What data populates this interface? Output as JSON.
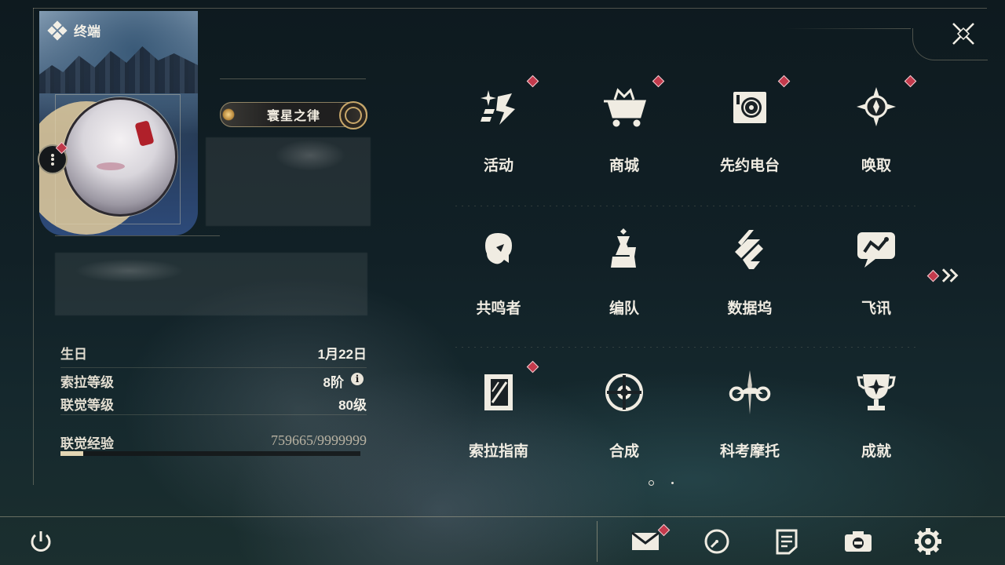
{
  "header": {
    "title": "终端"
  },
  "profile": {
    "title_badge": "寰星之律",
    "info": {
      "birthday_label": "生日",
      "birthday_value": "1月22日",
      "sola_level_label": "索拉等级",
      "sola_level_value": "8阶",
      "sola_info_icon": "i",
      "union_level_label": "联觉等级",
      "union_level_value": "80级",
      "union_exp_label": "联觉经验",
      "union_exp_value": "759665/9999999",
      "union_exp_progress": 0.076
    }
  },
  "menu": {
    "items": [
      {
        "label": "活动",
        "icon": "sparkle-icon",
        "badge": true
      },
      {
        "label": "商城",
        "icon": "shop-cart-icon",
        "badge": true
      },
      {
        "label": "先约电台",
        "icon": "radio-icon",
        "badge": true
      },
      {
        "label": "唤取",
        "icon": "compass-star-icon",
        "badge": true
      },
      {
        "label": "共鸣者",
        "icon": "resonator-portrait-icon",
        "badge": false
      },
      {
        "label": "编队",
        "icon": "chess-team-icon",
        "badge": false
      },
      {
        "label": "数据坞",
        "icon": "data-dock-icon",
        "badge": false
      },
      {
        "label": "飞讯",
        "icon": "chat-bubble-icon",
        "badge": false
      },
      {
        "label": "索拉指南",
        "icon": "guide-book-icon",
        "badge": true
      },
      {
        "label": "合成",
        "icon": "synthesis-icon",
        "badge": false
      },
      {
        "label": "科考摩托",
        "icon": "motorbike-icon",
        "badge": false
      },
      {
        "label": "成就",
        "icon": "trophy-icon",
        "badge": false
      }
    ]
  },
  "pagination": {
    "current": 1,
    "total": 2
  },
  "bottom_bar": {
    "icons": [
      "power-icon",
      "mail-icon",
      "clock-icon",
      "notes-icon",
      "camera-icon",
      "settings-icon"
    ],
    "mail_badge": true
  },
  "colors": {
    "accent_red": "#c33a4c",
    "gold": "#d8c49a",
    "text": "#f0ece2"
  }
}
